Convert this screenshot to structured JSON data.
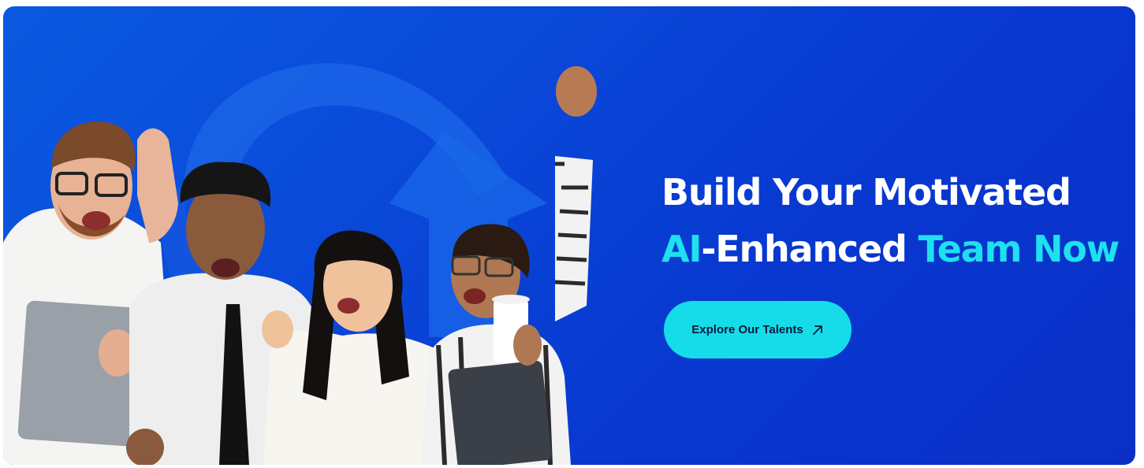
{
  "banner": {
    "headline_line1": "Build Your Motivated",
    "headline_line2_accent_a": "AI",
    "headline_line2_mid": "-Enhanced ",
    "headline_line2_accent_b": "Team Now",
    "cta_label": "Explore Our Talents",
    "cta_icon": "arrow-up-right-icon",
    "photo_subject": "team-celebrating-photo"
  },
  "colors": {
    "background": "#0a49d9",
    "accent": "#1fe0ee",
    "button": "#16dcea",
    "button_text": "#0b1a3c",
    "headline": "#ffffff"
  }
}
